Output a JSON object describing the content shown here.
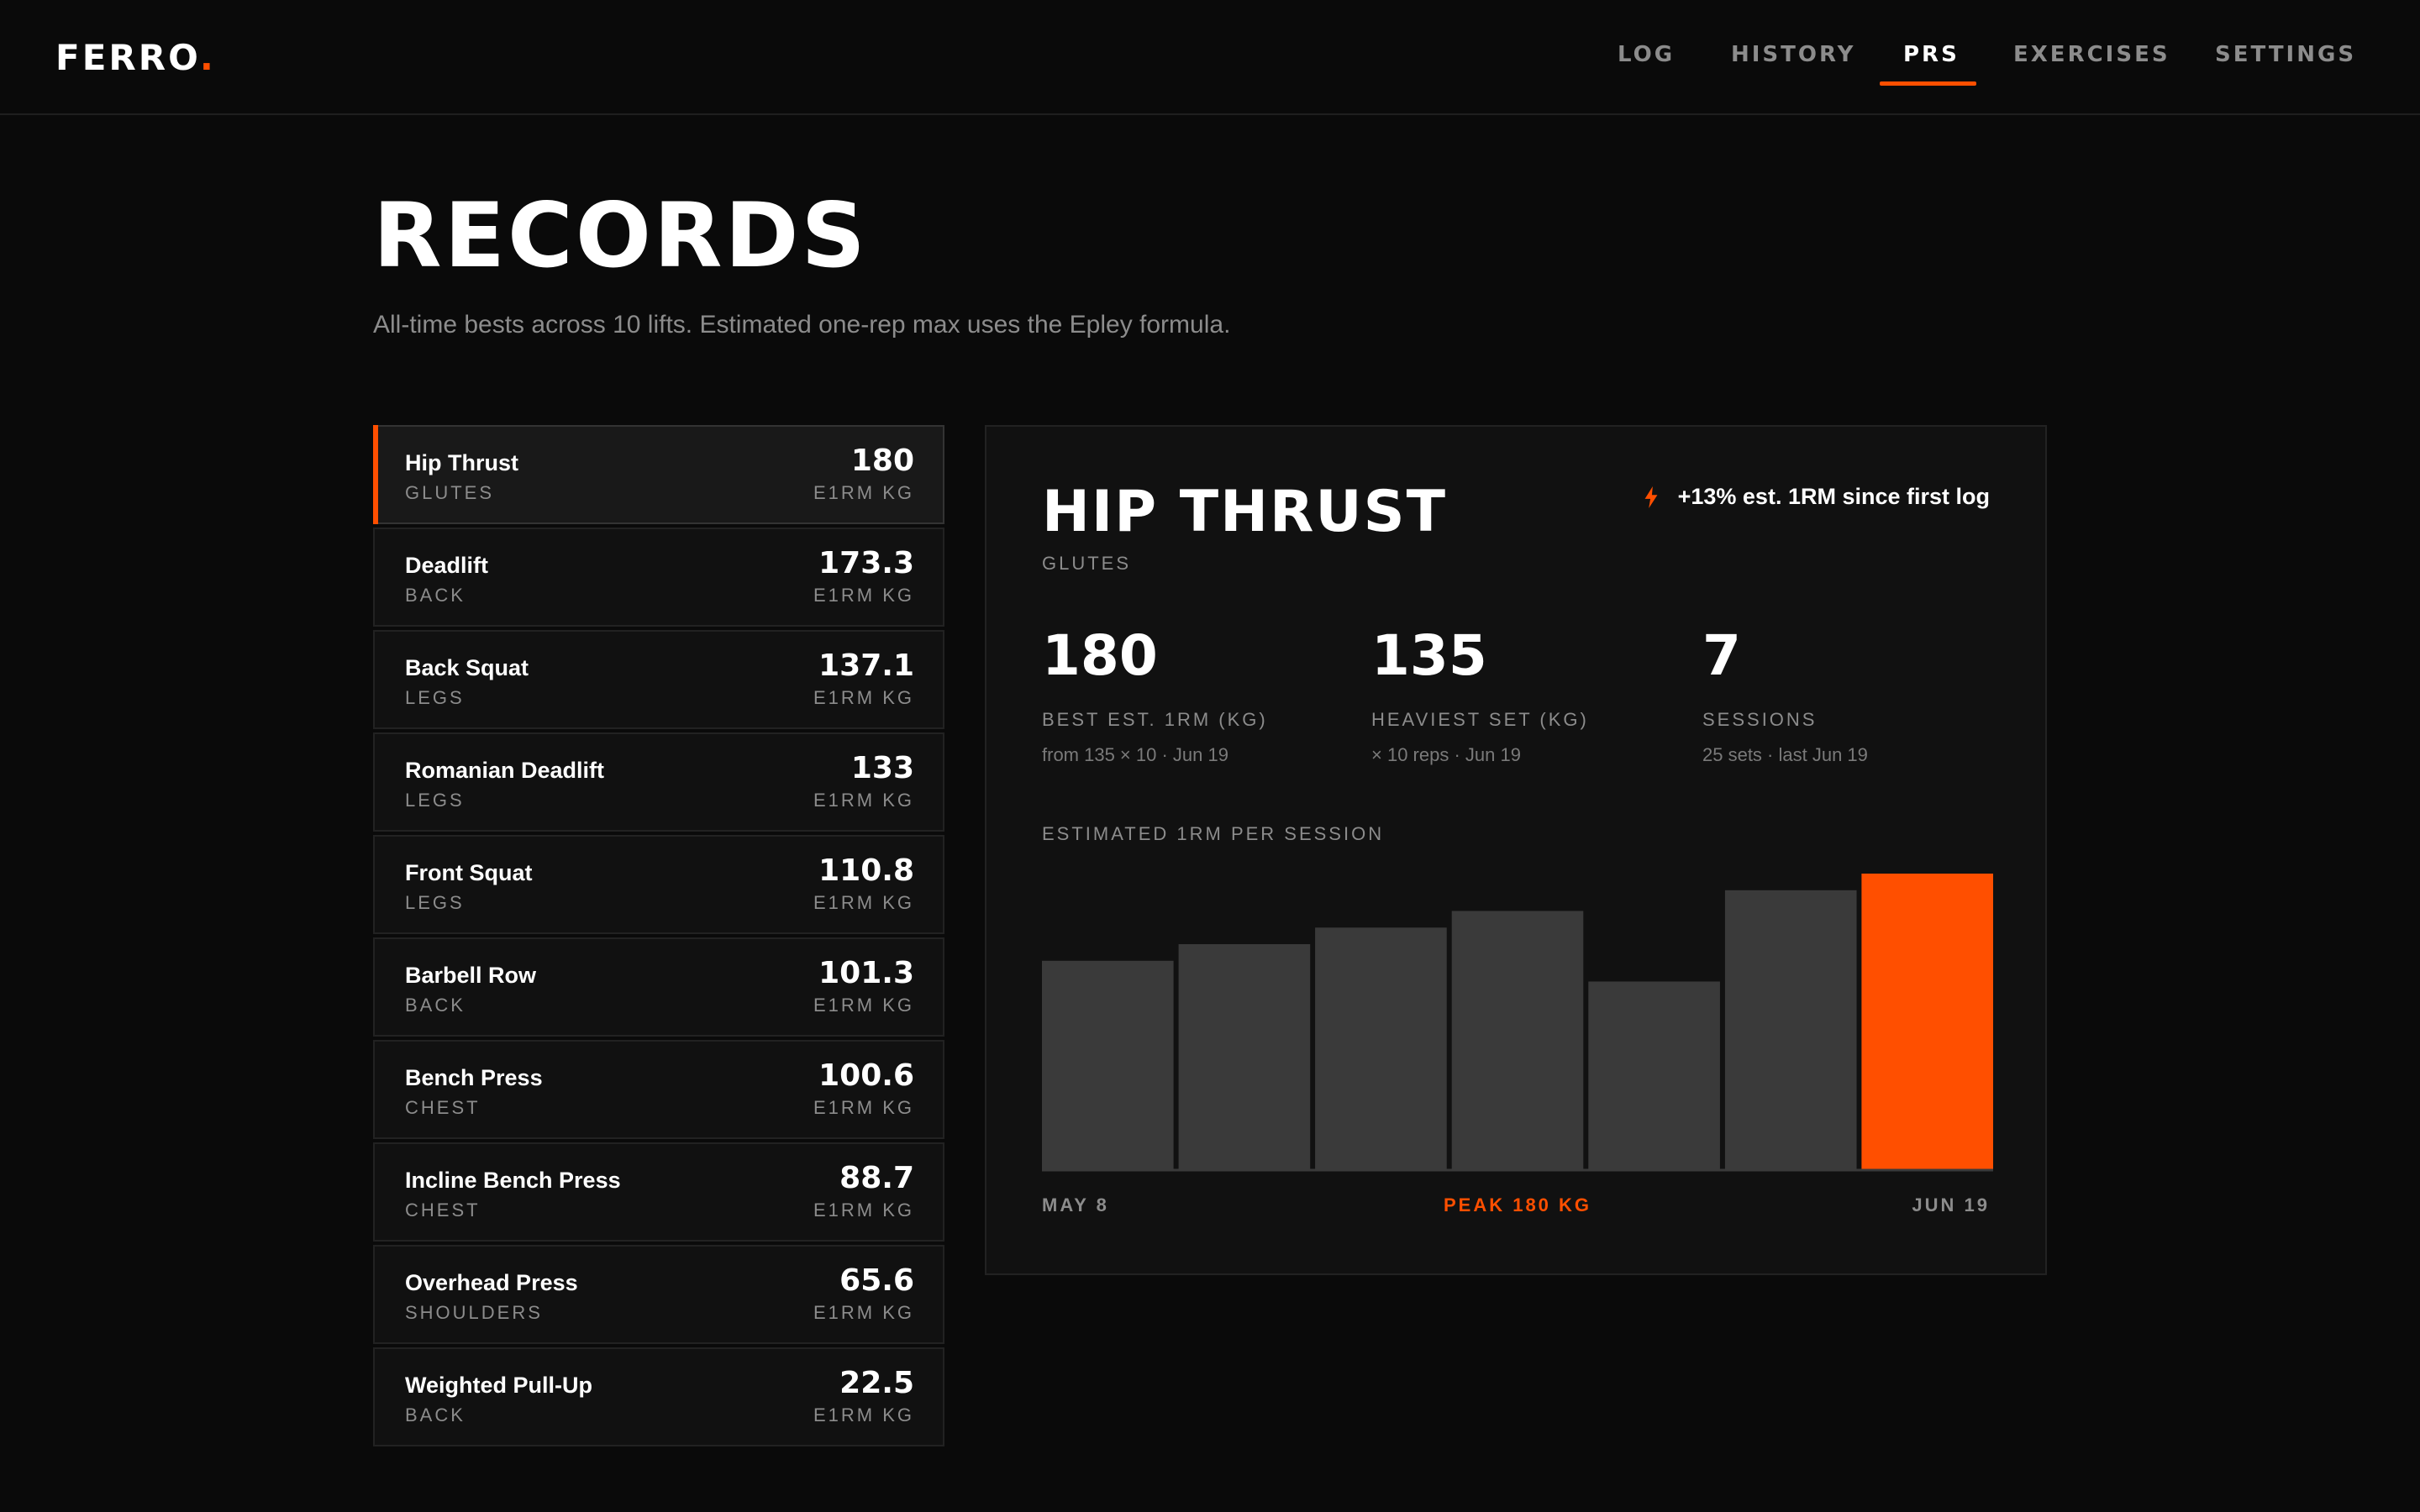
{
  "app": {
    "logo": "FERRO",
    "logo_dot": "."
  },
  "nav": [
    {
      "label": "LOG",
      "active": false
    },
    {
      "label": "HISTORY",
      "active": false
    },
    {
      "label": "PRS",
      "active": true
    },
    {
      "label": "EXERCISES",
      "active": false
    },
    {
      "label": "SETTINGS",
      "active": false
    }
  ],
  "header": {
    "title": "RECORDS",
    "subtitle": "All-time bests across 10 lifts. Estimated one-rep max uses the Epley formula."
  },
  "lifts": [
    {
      "name": "Hip Thrust",
      "category": "GLUTES",
      "value": "180",
      "unit": "E1RM KG",
      "selected": true
    },
    {
      "name": "Deadlift",
      "category": "BACK",
      "value": "173.3",
      "unit": "E1RM KG",
      "selected": false
    },
    {
      "name": "Back Squat",
      "category": "LEGS",
      "value": "137.1",
      "unit": "E1RM KG",
      "selected": false
    },
    {
      "name": "Romanian Deadlift",
      "category": "LEGS",
      "value": "133",
      "unit": "E1RM KG",
      "selected": false
    },
    {
      "name": "Front Squat",
      "category": "LEGS",
      "value": "110.8",
      "unit": "E1RM KG",
      "selected": false
    },
    {
      "name": "Barbell Row",
      "category": "BACK",
      "value": "101.3",
      "unit": "E1RM KG",
      "selected": false
    },
    {
      "name": "Bench Press",
      "category": "CHEST",
      "value": "100.6",
      "unit": "E1RM KG",
      "selected": false
    },
    {
      "name": "Incline Bench Press",
      "category": "CHEST",
      "value": "88.7",
      "unit": "E1RM KG",
      "selected": false
    },
    {
      "name": "Overhead Press",
      "category": "SHOULDERS",
      "value": "65.6",
      "unit": "E1RM KG",
      "selected": false
    },
    {
      "name": "Weighted Pull-Up",
      "category": "BACK",
      "value": "22.5",
      "unit": "E1RM KG",
      "selected": false
    }
  ],
  "detail": {
    "title": "HIP THRUST",
    "category": "GLUTES",
    "badge": "+13% est. 1RM since first log",
    "badge_icon": "bolt-icon",
    "stats": [
      {
        "value": "180",
        "label": "BEST EST. 1RM (KG)",
        "sub": "from 135 × 10 · Jun 19"
      },
      {
        "value": "135",
        "label": "HEAVIEST SET (KG)",
        "sub": "× 10 reps · Jun 19"
      },
      {
        "value": "7",
        "label": "SESSIONS",
        "sub": "25 sets · last Jun 19"
      }
    ],
    "chart_label": "ESTIMATED 1RM PER SESSION",
    "axis_start": "MAY 8",
    "axis_peak": "PEAK 180 KG",
    "axis_end": "JUN 19"
  },
  "colors": {
    "accent": "#ff4f00",
    "bar": "#3a3a3a",
    "background": "#0a0a0a",
    "panel": "#111111"
  },
  "chart_data": {
    "type": "bar",
    "categories": [
      "1",
      "2",
      "3",
      "4",
      "5",
      "6",
      "7"
    ],
    "values": [
      159,
      163,
      167,
      171,
      154,
      176,
      180
    ],
    "highlight_index": 6,
    "ylim": [
      140,
      180
    ],
    "title": "ESTIMATED 1RM PER SESSION",
    "xlabel": "",
    "ylabel": ""
  }
}
